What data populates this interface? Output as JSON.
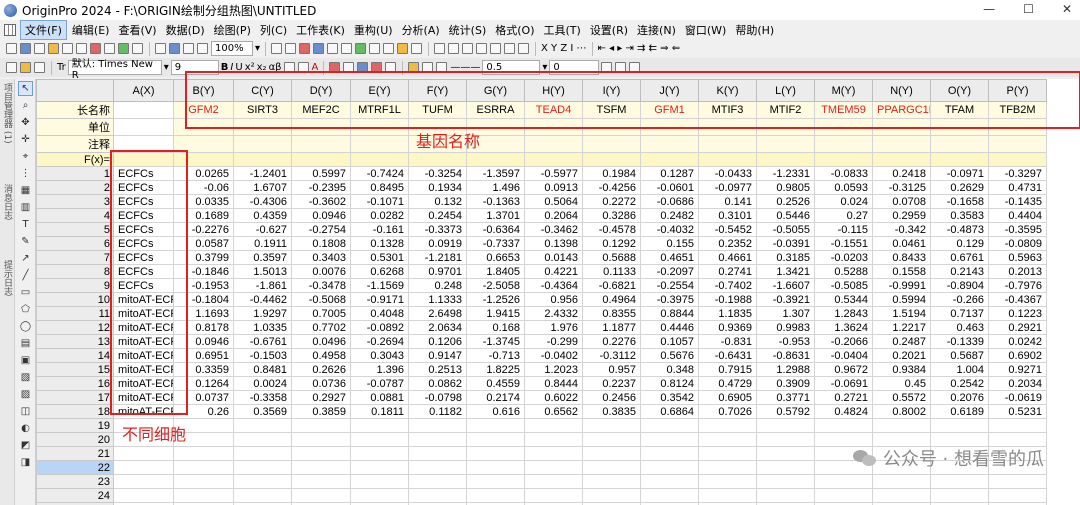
{
  "window": {
    "title": "OriginPro 2024 - F:\\ORIGIN绘制分组热图\\UNTITLED"
  },
  "menu": [
    "文件(F)",
    "编辑(E)",
    "查看(V)",
    "数据(D)",
    "绘图(P)",
    "列(C)",
    "工作表(K)",
    "重构(U)",
    "分析(A)",
    "统计(S)",
    "格式(O)",
    "工具(T)",
    "设置(R)",
    "连接(N)",
    "窗口(W)",
    "帮助(H)"
  ],
  "toolbar": {
    "zoom": "100%",
    "font_label": "默认: Times New R",
    "font_size": "9",
    "line_width": "0.5",
    "angle": "0"
  },
  "left_tabs": [
    "项目管理器 (1)",
    "消息日志",
    "提示日志"
  ],
  "sheet": {
    "row_labels": [
      "长名称",
      "单位",
      "注释",
      "F(x)="
    ],
    "columns": [
      {
        "head": "A(X)",
        "long": "",
        "red": false
      },
      {
        "head": "B(Y)",
        "long": "GFM2",
        "red": true
      },
      {
        "head": "C(Y)",
        "long": "SIRT3",
        "red": false
      },
      {
        "head": "D(Y)",
        "long": "MEF2C",
        "red": false
      },
      {
        "head": "E(Y)",
        "long": "MTRF1L",
        "red": false
      },
      {
        "head": "F(Y)",
        "long": "TUFM",
        "red": false
      },
      {
        "head": "G(Y)",
        "long": "ESRRA",
        "red": false
      },
      {
        "head": "H(Y)",
        "long": "TEAD4",
        "red": true
      },
      {
        "head": "I(Y)",
        "long": "TSFM",
        "red": false
      },
      {
        "head": "J(Y)",
        "long": "GFM1",
        "red": true
      },
      {
        "head": "K(Y)",
        "long": "MTIF3",
        "red": false
      },
      {
        "head": "L(Y)",
        "long": "MTIF2",
        "red": false
      },
      {
        "head": "M(Y)",
        "long": "TMEM59",
        "red": true
      },
      {
        "head": "N(Y)",
        "long": "PPARGC1B",
        "red": true
      },
      {
        "head": "O(Y)",
        "long": "TFAM",
        "red": false
      },
      {
        "head": "P(Y)",
        "long": "TFB2M",
        "red": false
      }
    ],
    "rows": [
      [
        "ECFCs",
        "0.0265",
        "-1.2401",
        "0.5997",
        "-0.7424",
        "-0.3254",
        "-1.3597",
        "-0.5977",
        "0.1984",
        "0.1287",
        "-0.0433",
        "-1.2331",
        "-0.0833",
        "0.2418",
        "-0.0971",
        "-0.3297"
      ],
      [
        "ECFCs",
        "-0.06",
        "1.6707",
        "-0.2395",
        "0.8495",
        "0.1934",
        "1.496",
        "0.0913",
        "-0.4256",
        "-0.0601",
        "-0.0977",
        "0.9805",
        "0.0593",
        "-0.3125",
        "0.2629",
        "0.4731"
      ],
      [
        "ECFCs",
        "0.0335",
        "-0.4306",
        "-0.3602",
        "-0.1071",
        "0.132",
        "-0.1363",
        "0.5064",
        "0.2272",
        "-0.0686",
        "0.141",
        "0.2526",
        "0.024",
        "0.0708",
        "-0.1658",
        "-0.1435"
      ],
      [
        "ECFCs",
        "0.1689",
        "0.4359",
        "0.0946",
        "0.0282",
        "0.2454",
        "1.3701",
        "0.2064",
        "0.3286",
        "0.2482",
        "0.3101",
        "0.5446",
        "0.27",
        "0.2959",
        "0.3583",
        "0.4404"
      ],
      [
        "ECFCs",
        "-0.2276",
        "-0.627",
        "-0.2754",
        "-0.161",
        "-0.3373",
        "-0.6364",
        "-0.3462",
        "-0.4578",
        "-0.4032",
        "-0.5452",
        "-0.5055",
        "-0.115",
        "-0.342",
        "-0.4873",
        "-0.3595"
      ],
      [
        "ECFCs",
        "0.0587",
        "0.1911",
        "0.1808",
        "0.1328",
        "0.0919",
        "-0.7337",
        "0.1398",
        "0.1292",
        "0.155",
        "0.2352",
        "-0.0391",
        "-0.1551",
        "0.0461",
        "0.129",
        "-0.0809"
      ],
      [
        "ECFCs",
        "0.3799",
        "0.3597",
        "0.3403",
        "0.5301",
        "-1.2181",
        "0.6653",
        "0.0143",
        "0.5688",
        "0.4651",
        "0.4661",
        "0.3185",
        "-0.0203",
        "0.8433",
        "0.6761",
        "0.5963"
      ],
      [
        "ECFCs",
        "-0.1846",
        "1.5013",
        "0.0076",
        "0.6268",
        "0.9701",
        "1.8405",
        "0.4221",
        "0.1133",
        "-0.2097",
        "0.2741",
        "1.3421",
        "0.5288",
        "0.1558",
        "0.2143",
        "0.2013"
      ],
      [
        "ECFCs",
        "-0.1953",
        "-1.861",
        "-0.3478",
        "-1.1569",
        "0.248",
        "-2.5058",
        "-0.4364",
        "-0.6821",
        "-0.2554",
        "-0.7402",
        "-1.6607",
        "-0.5085",
        "-0.9991",
        "-0.8904",
        "-0.7976"
      ],
      [
        "mitoAT-ECF",
        "-0.1804",
        "-0.4462",
        "-0.5068",
        "-0.9171",
        "1.1333",
        "-1.2526",
        "0.956",
        "0.4964",
        "-0.3975",
        "-0.1988",
        "-0.3921",
        "0.5344",
        "0.5994",
        "-0.266",
        "-0.4367"
      ],
      [
        "mitoAT-ECF",
        "1.1693",
        "1.9297",
        "0.7005",
        "0.4048",
        "2.6498",
        "1.9415",
        "2.4332",
        "0.8355",
        "0.8844",
        "1.1835",
        "1.307",
        "1.2843",
        "1.5194",
        "0.7137",
        "0.1223"
      ],
      [
        "mitoAT-ECF",
        "0.8178",
        "1.0335",
        "0.7702",
        "-0.0892",
        "2.0634",
        "0.168",
        "1.976",
        "1.1877",
        "0.4446",
        "0.9369",
        "0.9983",
        "1.3624",
        "1.2217",
        "0.463",
        "0.2921"
      ],
      [
        "mitoAT-ECF",
        "0.0946",
        "-0.6761",
        "0.0496",
        "-0.2694",
        "0.1206",
        "-1.3745",
        "-0.299",
        "0.2276",
        "0.1057",
        "-0.831",
        "-0.953",
        "-0.2066",
        "0.2487",
        "-0.1339",
        "0.0242"
      ],
      [
        "mitoAT-ECF",
        "0.6951",
        "-0.1503",
        "0.4958",
        "0.3043",
        "0.9147",
        "-0.713",
        "-0.0402",
        "-0.3112",
        "0.5676",
        "-0.6431",
        "-0.8631",
        "-0.0404",
        "0.2021",
        "0.5687",
        "0.6902"
      ],
      [
        "mitoAT-ECF",
        "0.3359",
        "0.8481",
        "0.2626",
        "1.396",
        "0.2513",
        "1.8225",
        "1.2023",
        "0.957",
        "0.348",
        "0.7915",
        "1.2988",
        "0.9672",
        "0.9384",
        "1.004",
        "0.9271"
      ],
      [
        "mitoAT-ECF",
        "0.1264",
        "0.0024",
        "0.0736",
        "-0.0787",
        "0.0862",
        "0.4559",
        "0.8444",
        "0.2237",
        "0.8124",
        "0.4729",
        "0.3909",
        "-0.0691",
        "0.45",
        "0.2542",
        "0.2034"
      ],
      [
        "mitoAT-ECF",
        "0.0737",
        "-0.3358",
        "0.2927",
        "0.0881",
        "-0.0798",
        "0.2174",
        "0.6022",
        "0.2456",
        "0.3542",
        "0.6905",
        "0.3771",
        "0.2721",
        "0.5572",
        "0.2076",
        "-0.0619"
      ],
      [
        "mitoAT-ECF",
        "0.26",
        "0.3569",
        "0.3859",
        "0.1811",
        "0.1182",
        "0.616",
        "0.6562",
        "0.3835",
        "0.6864",
        "0.7026",
        "0.5792",
        "0.4824",
        "0.8002",
        "0.6189",
        "0.5231"
      ]
    ],
    "total_rows": 25,
    "selected_row": 22
  },
  "annotations": {
    "genes_label": "基因名称",
    "cells_label": "不同细胞",
    "annot_color": "#e02020"
  },
  "watermark": "公众号 · 想看雪的瓜"
}
